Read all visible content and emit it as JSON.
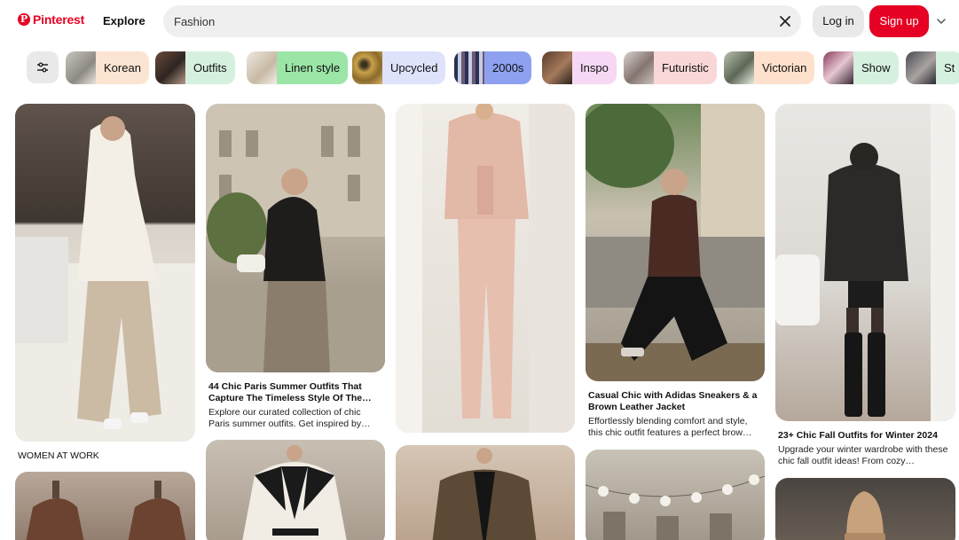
{
  "header": {
    "logo_text": "Pinterest",
    "explore_label": "Explore",
    "search_value": "Fashion",
    "login_label": "Log in",
    "signup_label": "Sign up"
  },
  "chips": [
    {
      "label": "Korean",
      "color": "#fbe4d2"
    },
    {
      "label": "Outfits",
      "color": "#d6f0df"
    },
    {
      "label": "Linen style",
      "color": "#9be5a6"
    },
    {
      "label": "Upcycled",
      "color": "#dfe2fb"
    },
    {
      "label": "2000s",
      "color": "#8ea1f0"
    },
    {
      "label": "Inspo",
      "color": "#f6d8f4"
    },
    {
      "label": "Futuristic",
      "color": "#fad7d7"
    },
    {
      "label": "Victorian",
      "color": "#fde1cc"
    },
    {
      "label": "Show",
      "color": "#d6f0df"
    },
    {
      "label": "St",
      "color": "#d6f0df"
    }
  ],
  "pins": [
    {
      "caption": "WOMEN AT WORK"
    },
    {
      "title": "44 Chic Paris Summer Outfits That Capture The Timeless Style Of The Cit…",
      "description": "Explore our curated collection of chic Paris summer outfits. Get inspired by…"
    },
    {
      "title": ""
    },
    {
      "title": "Casual Chic with Adidas Sneakers & a Brown Leather Jacket",
      "description": "Effortlessly blending comfort and style, this chic outfit features a perfect brow…"
    },
    {
      "title": "23+ Chic Fall Outfits for Winter 2024",
      "description": "Upgrade your winter wardrobe with these chic fall outfit ideas! From cozy…"
    }
  ],
  "colors": {
    "brand": "#e60023",
    "search_bg": "#efefef",
    "button_gray": "#e9e9e9"
  }
}
